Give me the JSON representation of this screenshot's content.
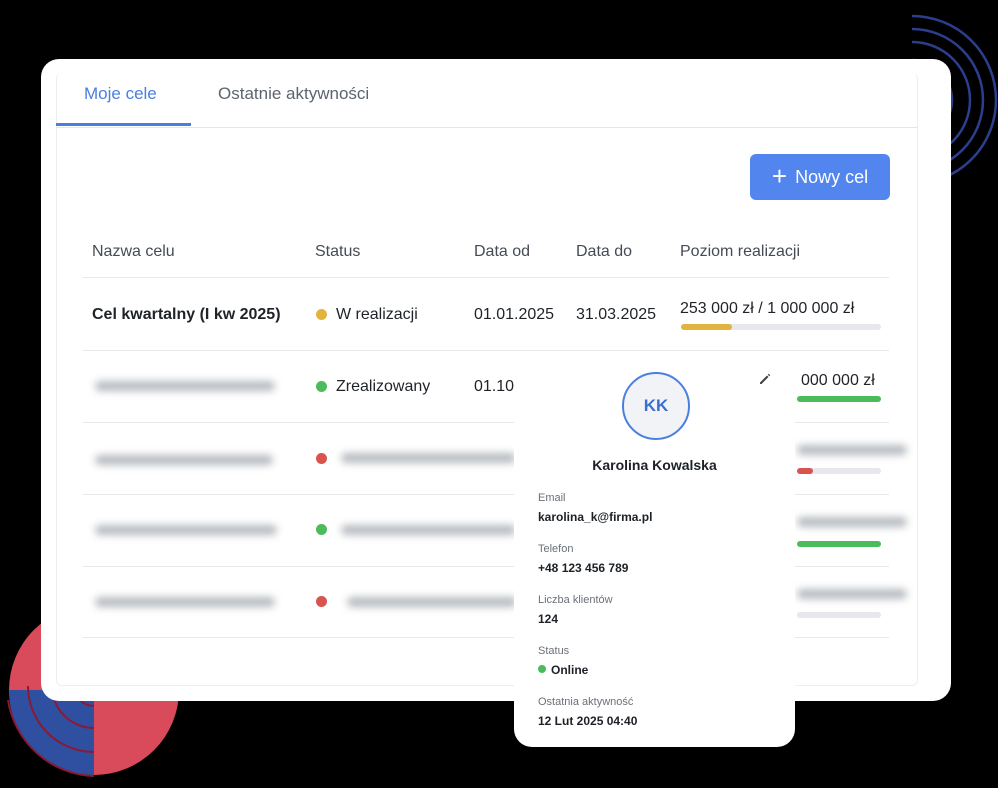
{
  "tabs": [
    {
      "label": "Moje cele",
      "active": true
    },
    {
      "label": "Ostatnie aktywności",
      "active": false
    }
  ],
  "new_goal_button": {
    "label": "Nowy cel",
    "icon": "plus-icon"
  },
  "table": {
    "headers": [
      "Nazwa celu",
      "Status",
      "Data od",
      "Data do",
      "Poziom realizacji"
    ],
    "rows": [
      {
        "name": "Cel kwartalny (I kw 2025)",
        "status": "W realizacji",
        "status_color": "#e3b341",
        "date_from": "01.01.2025",
        "date_to": "31.03.2025",
        "progress_text": "253 000 zł / 1 000 000 zł",
        "progress": 0.253,
        "progress_color": "#e3b341"
      },
      {
        "name": "",
        "status": "Zrealizowany",
        "status_color": "#4cbb5b",
        "date_from": "01.10.",
        "progress_text": "000 000 zł",
        "progress": 1.0,
        "progress_color": "#4cbb5b"
      },
      {
        "status_color": "#d9534f",
        "progress_color": "#d9534f"
      },
      {
        "status_color": "#4cbb5b",
        "progress_color": "#4cbb5b"
      },
      {
        "status_color": "#d9534f"
      }
    ]
  },
  "profile_card": {
    "initials": "KK",
    "name": "Karolina Kowalska",
    "fields": [
      {
        "label": "Email",
        "value": "karolina_k@firma.pl"
      },
      {
        "label": "Telefon",
        "value": "+48 123 456 789"
      },
      {
        "label": "Liczba klientów",
        "value": "124"
      },
      {
        "label": "Status",
        "value": "Online"
      },
      {
        "label": "Ostatnia aktywność",
        "value": "12 Lut 2025 04:40"
      }
    ],
    "status_color": "#4cbb5b",
    "edit_icon": "pencil-icon"
  },
  "colors": {
    "accent": "#4a7fe0",
    "button": "#5286ee",
    "deco_arcs": "#2c3f8f",
    "deco_circle": "#d94a5a"
  }
}
